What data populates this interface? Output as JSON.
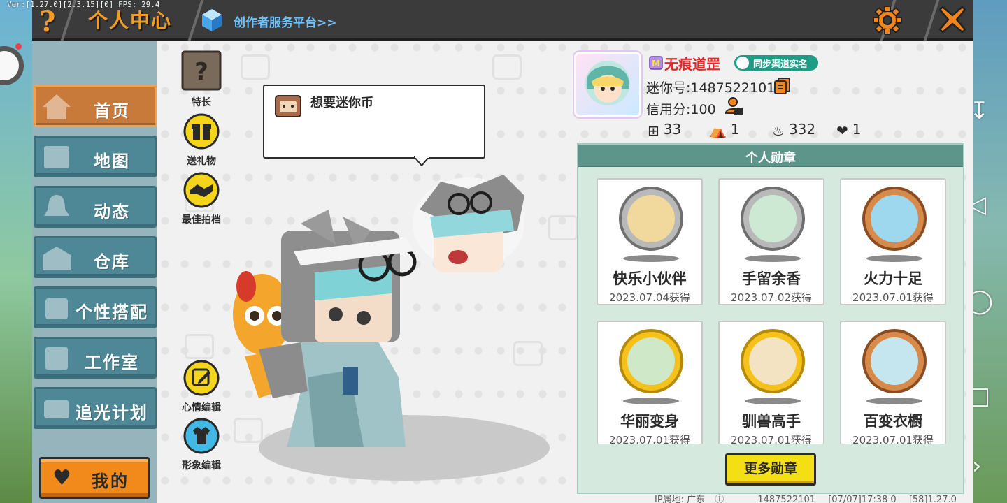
{
  "status_overlay": {
    "version": "Ver:[1.27.0][2.3.15][0] FPS: 29.4"
  },
  "header": {
    "help_symbol": "?",
    "title": "个人中心",
    "creator_link": "创作者服务平台>>"
  },
  "sidebar": {
    "items": [
      {
        "label": "首页",
        "active": true,
        "icon": "home-icon"
      },
      {
        "label": "地图",
        "active": false,
        "icon": "map-icon"
      },
      {
        "label": "动态",
        "active": false,
        "icon": "bell-icon"
      },
      {
        "label": "仓库",
        "active": false,
        "icon": "warehouse-icon"
      },
      {
        "label": "个性搭配",
        "active": false,
        "icon": "outfit-icon"
      },
      {
        "label": "工作室",
        "active": false,
        "icon": "studio-icon"
      },
      {
        "label": "追光计划",
        "active": false,
        "icon": "light-plan-icon"
      }
    ],
    "my_button": "我的"
  },
  "actions": {
    "specialty": "特长",
    "send_gift": "送礼物",
    "best_photo": "最佳拍档",
    "mood_edit": "心情编辑",
    "avatar_edit": "形象编辑"
  },
  "bubble": {
    "text": "想要迷你币"
  },
  "profile": {
    "username": "无痕道罡",
    "sync_badge": "同步渠道实名",
    "mini_id": "迷你号:1487522101",
    "credit": "信用分:100",
    "stats": [
      {
        "icon": "plus-square-icon",
        "value": "33"
      },
      {
        "icon": "fans-icon",
        "value": "1"
      },
      {
        "icon": "flame-icon",
        "value": "332"
      },
      {
        "icon": "hearts-icon",
        "value": "1"
      }
    ]
  },
  "medals": {
    "title": "个人勋章",
    "items": [
      {
        "name": "快乐小伙伴",
        "date": "2023.07.04获得",
        "tier": "silver"
      },
      {
        "name": "手留余香",
        "date": "2023.07.02获得",
        "tier": "silver"
      },
      {
        "name": "火力十足",
        "date": "2023.07.01获得",
        "tier": "bronze"
      },
      {
        "name": "华丽变身",
        "date": "2023.07.01获得",
        "tier": "gold"
      },
      {
        "name": "驯兽高手",
        "date": "2023.07.01获得",
        "tier": "gold"
      },
      {
        "name": "百变衣橱",
        "date": "2023.07.01获得",
        "tier": "bronze"
      }
    ],
    "more_button": "更多勋章"
  },
  "footer": {
    "ip": "IP属地: 广东",
    "uid": "1487522101",
    "timestamp": "[07/07]17:38 0",
    "version": "[58]1.27.0"
  },
  "colors": {
    "accent_orange": "#f39c23",
    "nav_teal": "#4e8795",
    "nav_active": "#c77a3a",
    "username_red": "#e6262a",
    "medal_panel": "#d6e9df",
    "more_button": "#f4de14"
  }
}
